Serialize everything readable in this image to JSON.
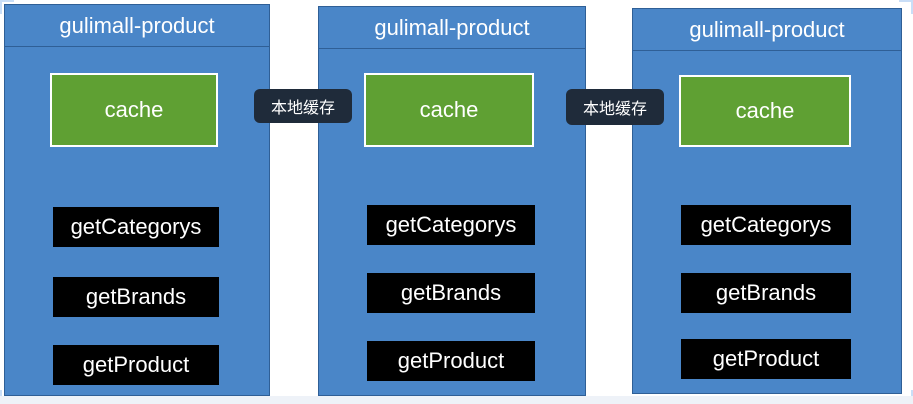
{
  "services": [
    {
      "title": "gulimall-product",
      "cache_label": "cache",
      "methods": [
        "getCategorys",
        "getBrands",
        "getProduct"
      ]
    },
    {
      "title": "gulimall-product",
      "cache_label": "cache",
      "methods": [
        "getCategorys",
        "getBrands",
        "getProduct"
      ]
    },
    {
      "title": "gulimall-product",
      "cache_label": "cache",
      "methods": [
        "getCategorys",
        "getBrands",
        "getProduct"
      ]
    }
  ],
  "connectors": [
    {
      "label": "本地缓存"
    },
    {
      "label": "本地缓存"
    }
  ],
  "colors": {
    "service_bg": "#4a86c8",
    "cache_bg": "#5fa033",
    "method_bg": "#000000",
    "label_bg": "#1f2b3a"
  }
}
